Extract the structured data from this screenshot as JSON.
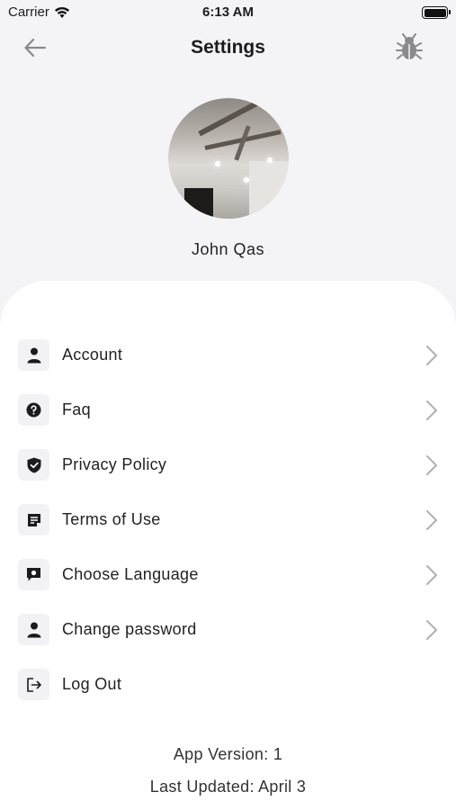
{
  "status_bar": {
    "carrier": "Carrier",
    "time": "6:13 AM"
  },
  "nav": {
    "title": "Settings"
  },
  "profile": {
    "name": "John Qas"
  },
  "menu": [
    {
      "label": "Account",
      "icon": "person-icon",
      "chevron": true
    },
    {
      "label": "Faq",
      "icon": "question-circle-icon",
      "chevron": true
    },
    {
      "label": "Privacy Policy",
      "icon": "shield-check-icon",
      "chevron": true
    },
    {
      "label": "Terms of Use",
      "icon": "document-note-icon",
      "chevron": true
    },
    {
      "label": "Choose Language",
      "icon": "chat-bubble-icon",
      "chevron": true
    },
    {
      "label": "Change password",
      "icon": "person-icon",
      "chevron": true
    },
    {
      "label": "Log Out",
      "icon": "logout-icon",
      "chevron": false
    }
  ],
  "footer": {
    "version": "App Version:  1",
    "updated": "Last Updated: April 3"
  },
  "colors": {
    "background": "#f4f4f6",
    "sheet": "#ffffff",
    "icon_bg": "#f2f2f4",
    "chevron": "#b0b0b5"
  }
}
